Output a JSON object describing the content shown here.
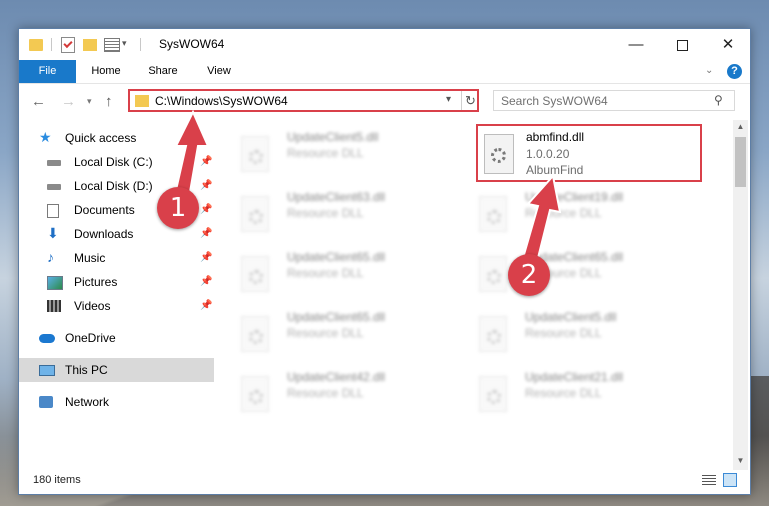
{
  "window": {
    "title": "SysWOW64",
    "controls": {
      "minimize": "—",
      "maximize": "",
      "close": "✕"
    }
  },
  "ribbon": {
    "tabs": [
      "File",
      "Home",
      "Share",
      "View"
    ],
    "help": "?"
  },
  "address": {
    "path": "C:\\Windows\\SysWOW64",
    "refresh": "↻"
  },
  "search": {
    "placeholder": "Search SysWOW64"
  },
  "sidebar": {
    "items": [
      {
        "label": "Quick access",
        "icon": "star-icon"
      },
      {
        "label": "Local Disk (C:)",
        "icon": "drive-icon",
        "pinned": true
      },
      {
        "label": "Local Disk (D:)",
        "icon": "drive-icon",
        "pinned": true
      },
      {
        "label": "Documents",
        "icon": "documents-icon",
        "pinned": true
      },
      {
        "label": "Downloads",
        "icon": "download-icon",
        "pinned": true
      },
      {
        "label": "Music",
        "icon": "music-icon",
        "pinned": true
      },
      {
        "label": "Pictures",
        "icon": "pictures-icon",
        "pinned": true
      },
      {
        "label": "Videos",
        "icon": "videos-icon",
        "pinned": true
      },
      {
        "label": "OneDrive",
        "icon": "cloud-icon"
      },
      {
        "label": "This PC",
        "icon": "computer-icon",
        "selected": true
      },
      {
        "label": "Network",
        "icon": "network-icon"
      }
    ]
  },
  "files": [
    {
      "name": "UpdateClient5.dll",
      "desc": "Resource DLL"
    },
    {
      "name": "UpdateClient63.dll",
      "desc": "Resource DLL"
    },
    {
      "name": "UpdateClient19.dll",
      "desc": "Resource DLL"
    },
    {
      "name": "UpdateClient65.dll",
      "desc": "Resource DLL"
    },
    {
      "name": "UpdateClient65.dll",
      "desc": "Resource DLL"
    },
    {
      "name": "UpdateClient65.dll",
      "desc": "Resource DLL"
    },
    {
      "name": "UpdateClient5.dll",
      "desc": "Resource DLL"
    },
    {
      "name": "UpdateClient42.dll",
      "desc": "Resource DLL"
    },
    {
      "name": "UpdateClient21.dll",
      "desc": "Resource DLL"
    }
  ],
  "highlighted_file": {
    "name": "abmfind.dll",
    "version": "1.0.0.20",
    "desc": "AlbumFind"
  },
  "status": {
    "items": "180 items"
  },
  "annotations": {
    "step1": "1",
    "step2": "2",
    "color": "#d9404a"
  },
  "colors": {
    "accent": "#1979ca",
    "highlight": "#d9404a",
    "folder": "#f3c952"
  }
}
